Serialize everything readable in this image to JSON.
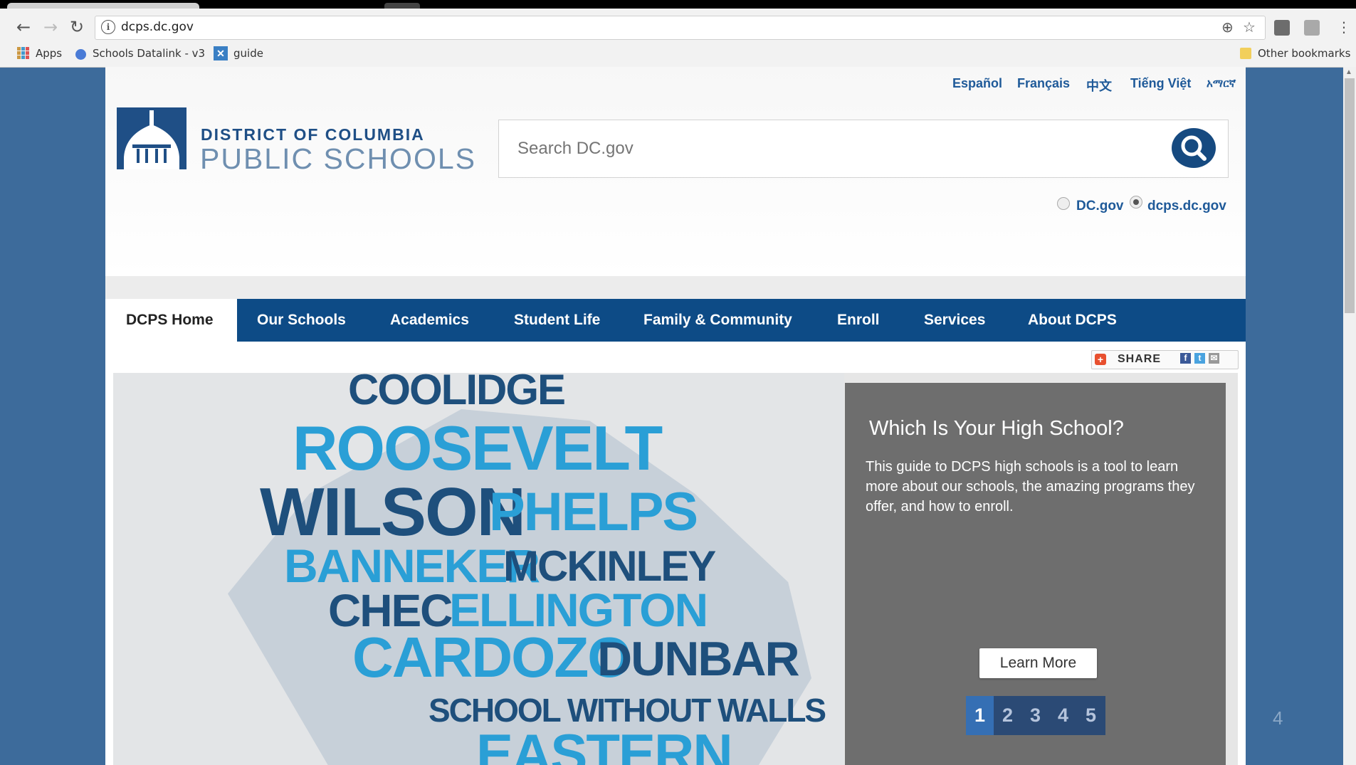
{
  "browser": {
    "url": "dcps.dc.gov",
    "bookmarks": [
      {
        "label": "Apps",
        "icon": "apps-grid-icon"
      },
      {
        "label": "Schools Datalink - v3",
        "icon": "globe-icon"
      },
      {
        "label": "guide",
        "icon": "guide-icon"
      }
    ],
    "other_bookmarks": "Other bookmarks"
  },
  "site": {
    "languages": [
      "Español",
      "Français",
      "中文",
      "Tiếng Việt",
      "አማርኛ"
    ],
    "logo": {
      "line1": "DISTRICT OF COLUMBIA",
      "line2": "PUBLIC SCHOOLS"
    },
    "search": {
      "placeholder": "Search DC.gov",
      "scope_options": [
        "DC.gov",
        "dcps.dc.gov"
      ],
      "selected_scope": "dcps.dc.gov"
    },
    "nav": [
      "DCPS Home",
      "Our Schools",
      "Academics",
      "Student Life",
      "Family & Community",
      "Enroll",
      "Services",
      "About DCPS"
    ],
    "active_nav": "DCPS Home",
    "share_label": "SHARE",
    "hero": {
      "words": [
        "COOLIDGE",
        "ROOSEVELT",
        "WILSON",
        "PHELPS",
        "BANNEKER",
        "MCKINLEY",
        "CHEC",
        "ELLINGTON",
        "CARDOZO",
        "DUNBAR",
        "SCHOOL WITHOUT WALLS",
        "EASTERN"
      ],
      "panel": {
        "title": "Which Is Your High School?",
        "body": "This guide to DCPS high schools is a tool to learn more about our schools, the amazing programs they offer, and how to enroll.",
        "button": "Learn More"
      },
      "pager": [
        "1",
        "2",
        "3",
        "4",
        "5"
      ],
      "active_page": "1"
    }
  },
  "slide_number": "4",
  "colors": {
    "nav_bg": "#0d4b86",
    "link": "#1f5a99",
    "panel_bg": "#6e6e6e",
    "pager_active": "#356fb4",
    "word_dark": "#1e4f7c",
    "word_light": "#2a9fd6",
    "outer_bg": "#3d6b9b"
  }
}
